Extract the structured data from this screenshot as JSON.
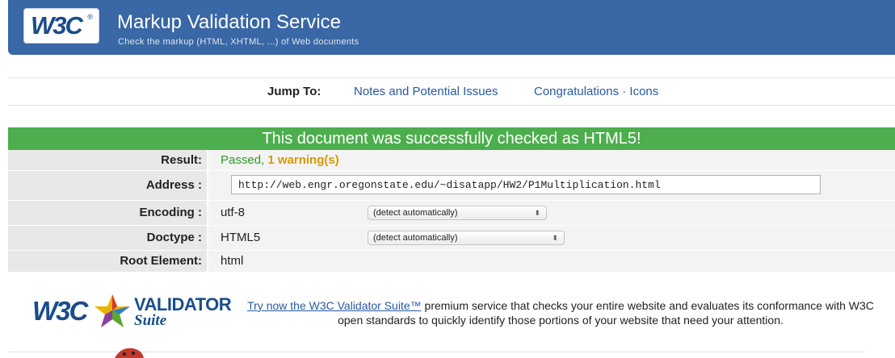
{
  "header": {
    "logo": "W3C",
    "title": "Markup Validation Service",
    "subtitle": "Check the markup (HTML, XHTML, ...) of Web documents"
  },
  "jump": {
    "label": "Jump To:",
    "links": [
      "Notes and Potential Issues",
      "Congratulations · Icons"
    ]
  },
  "result": {
    "banner": "This document was successfully checked as HTML5!",
    "rows": {
      "result_label": "Result:",
      "result_passed": "Passed, ",
      "result_warning": "1 warning(s)",
      "address_label": "Address :",
      "address_value": "http://web.engr.oregonstate.edu/~disatapp/HW2/P1Multiplication.html",
      "encoding_label": "Encoding :",
      "encoding_value": "utf-8",
      "encoding_select": "(detect automatically)",
      "doctype_label": "Doctype :",
      "doctype_value": "HTML5",
      "doctype_select": "(detect automatically)",
      "root_label": "Root Element:",
      "root_value": "html"
    }
  },
  "promo": {
    "logo_w3c": "W3C",
    "logo_validator": "VALIDATOR",
    "logo_suite": "Suite",
    "link_text": "Try now the W3C Validator Suite™",
    "text": " premium service that checks your entire website and evaluates its conformance with W3C open standards to quickly identify those portions of your website that need your attention."
  },
  "colors": {
    "banner": "#3a67a5",
    "success": "#4cae4c",
    "warning": "#d49a00",
    "link": "#2a58a0"
  }
}
